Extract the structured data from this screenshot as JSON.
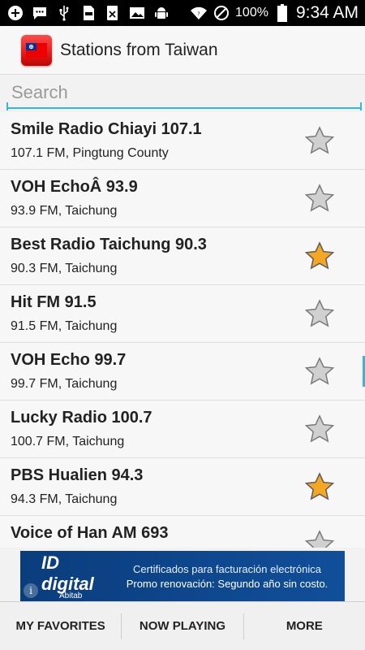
{
  "status_bar": {
    "battery_percent": "100%",
    "time": "9:34 AM"
  },
  "action_bar": {
    "title": "Stations from Taiwan"
  },
  "search": {
    "placeholder": "Search"
  },
  "stations": [
    {
      "name": "Smile Radio Chiayi 107.1",
      "sub": "107.1 FM, Pingtung County",
      "favorite": false
    },
    {
      "name": "VOH EchoÂ  93.9",
      "sub": "93.9 FM, Taichung",
      "favorite": false
    },
    {
      "name": "Best Radio Taichung 90.3",
      "sub": "90.3 FM, Taichung",
      "favorite": true
    },
    {
      "name": "Hit FM 91.5",
      "sub": "91.5 FM, Taichung",
      "favorite": false
    },
    {
      "name": "VOH Echo 99.7",
      "sub": "99.7 FM, Taichung",
      "favorite": false
    },
    {
      "name": "Lucky Radio 100.7",
      "sub": "100.7 FM, Taichung",
      "favorite": false
    },
    {
      "name": "PBS Hualien 94.3",
      "sub": "94.3 FM, Taichung",
      "favorite": true
    },
    {
      "name": "Voice of Han AM 693",
      "sub": "",
      "favorite": false
    }
  ],
  "ad": {
    "logo_main": "ID digital",
    "logo_sub": "Abitab",
    "line1": "Certificados para facturación electrónica",
    "line2": "Promo renovación: Segundo año sin costo.",
    "info_glyph": "i"
  },
  "bottom_tabs": [
    {
      "label": "MY FAVORITES"
    },
    {
      "label": "NOW PLAYING"
    },
    {
      "label": "MORE"
    }
  ],
  "colors": {
    "accent": "#33b5e5",
    "star_favorite": "#f5a623",
    "star_default": "#c8c8c8"
  }
}
